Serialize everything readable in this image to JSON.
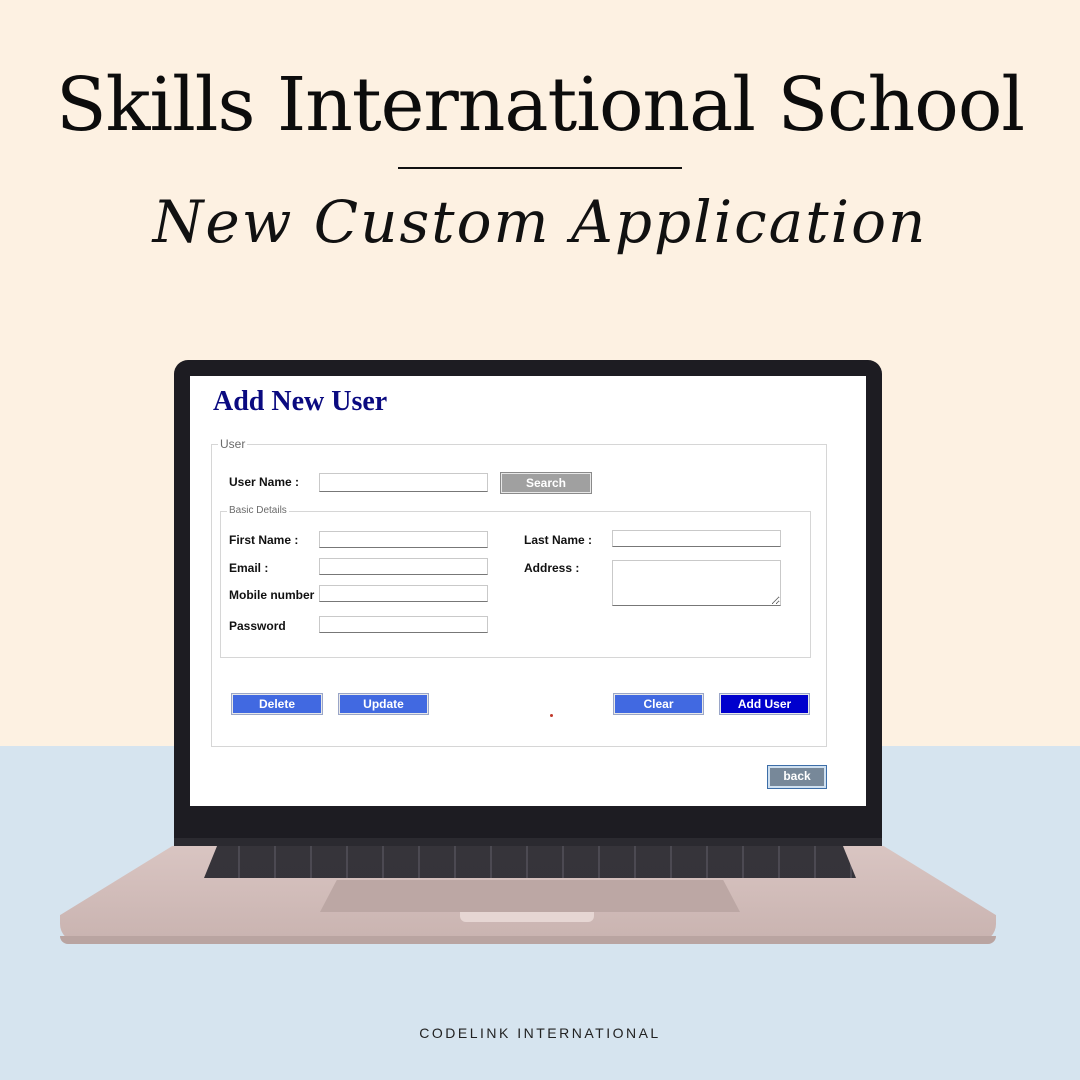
{
  "poster": {
    "headline": "Skills International School",
    "subhead": "New Custom Application",
    "footer": "CODELINK INTERNATIONAL"
  },
  "app": {
    "title": "Add New User",
    "user_group": {
      "legend": "User",
      "username_label": "User Name :",
      "username_value": "",
      "search_label": "Search"
    },
    "basic_details": {
      "legend": "Basic Details",
      "first_name_label": "First Name :",
      "email_label": "Email :",
      "mobile_label": "Mobile number",
      "password_label": "Password",
      "last_name_label": "Last Name :",
      "address_label": "Address :"
    },
    "actions": {
      "delete": "Delete",
      "update": "Update",
      "clear": "Clear",
      "add_user": "Add User"
    },
    "back_label": "back"
  },
  "colors": {
    "title": "#0a0a80",
    "button_blue": "#4169e1",
    "button_add": "#0000cd",
    "button_search": "#a0a0a0",
    "button_back": "#778899"
  }
}
